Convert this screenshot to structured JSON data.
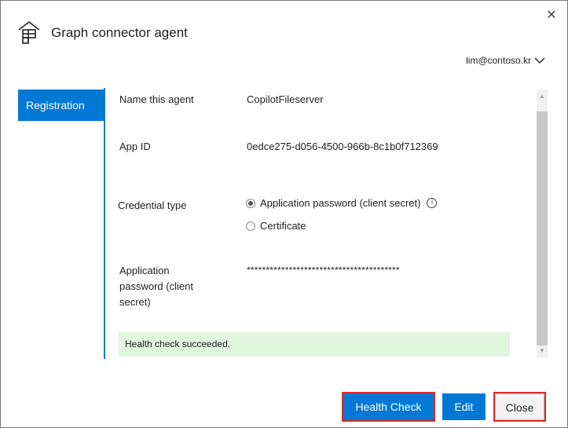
{
  "window": {
    "title": "Graph connector agent",
    "close_glyph": "✕",
    "account": "lim@contoso.kr",
    "app_icon": "graph-connector-icon"
  },
  "nav": {
    "active_tab": "Registration"
  },
  "form": {
    "agent_name_label": "Name this agent",
    "agent_name_value": "CopilotFileserver",
    "app_id_label": "App ID",
    "app_id_value": "0edce275-d056-4500-966b-8c1b0f712369",
    "credential_type_label": "Credential type",
    "credential_options": [
      {
        "label": "Application password (client secret)",
        "selected": true
      },
      {
        "label": "Certificate",
        "selected": false
      }
    ],
    "info_glyph": "i",
    "password_label_line1": "Application",
    "password_label_line2": "password (client",
    "password_label_line3": "secret)",
    "password_value": "****************************************"
  },
  "status": {
    "health_message": "Health check succeeded."
  },
  "buttons": {
    "health_check": "Health Check",
    "edit": "Edit",
    "close": "Close"
  },
  "colors": {
    "accent": "#0078d4",
    "success_bg": "#dff6dd",
    "highlight_border": "#d92b2b"
  }
}
